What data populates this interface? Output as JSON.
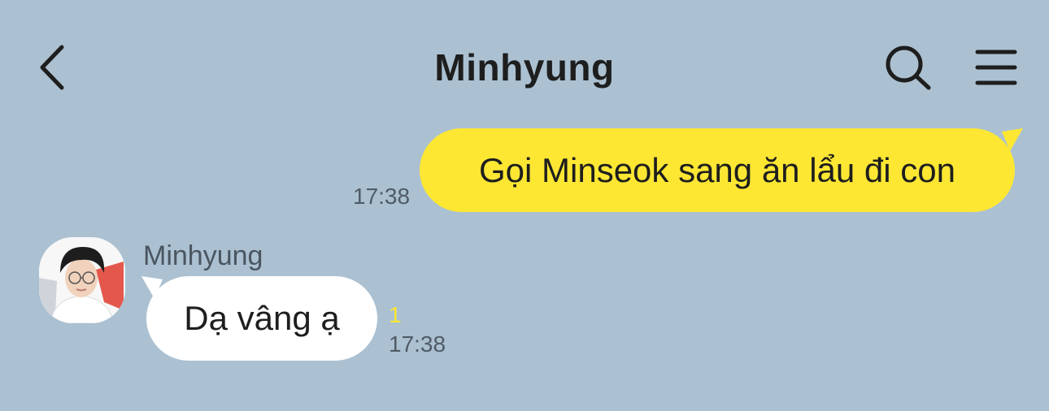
{
  "header": {
    "title": "Minhyung",
    "back_icon": "chevron-left-icon",
    "search_icon": "search-icon",
    "menu_icon": "hamburger-menu-icon"
  },
  "messages": [
    {
      "direction": "outgoing",
      "text": "Gọi Minseok sang ăn lẩu đi con",
      "time": "17:38"
    },
    {
      "direction": "incoming",
      "sender": "Minhyung",
      "text": "Dạ vâng ạ",
      "unread_count": "1",
      "time": "17:38"
    }
  ],
  "colors": {
    "background": "#abc1d2",
    "outgoing_bubble": "#fee733",
    "incoming_bubble": "#ffffff",
    "unread_count": "#fee733"
  }
}
